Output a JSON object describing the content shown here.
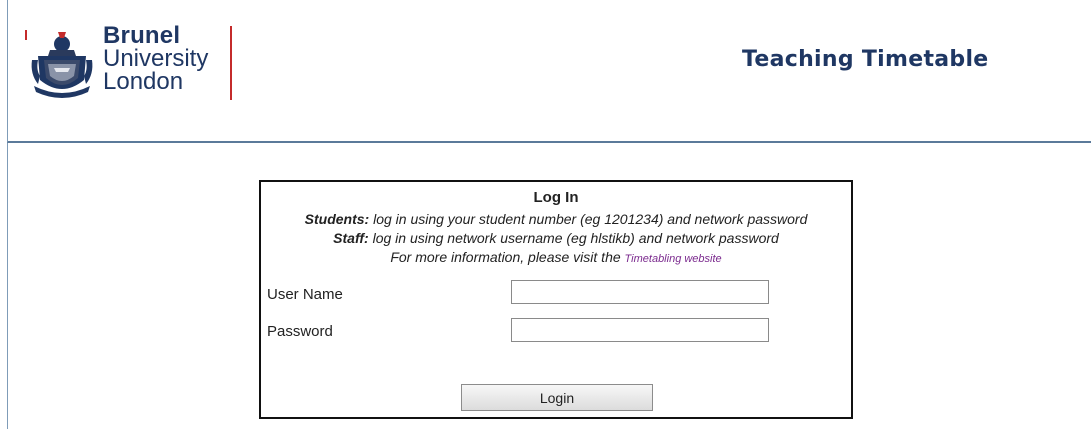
{
  "header": {
    "logo": {
      "line1": "Brunel",
      "line2": "University",
      "line3": "London"
    },
    "title": "Teaching Timetable"
  },
  "login": {
    "title": "Log In",
    "students_label": "Students:",
    "students_text": " log in using your student number (eg 1201234) and network password",
    "staff_label": "Staff:",
    "staff_text": " log in using network username (eg hlstikb) and network password",
    "info_text": "For more information, please visit the ",
    "link_text": "Timetabling website",
    "username_label": "User Name",
    "username_value": "",
    "password_label": "Password",
    "password_value": "",
    "button_label": "Login"
  },
  "colors": {
    "brand_navy": "#1f3763",
    "brand_red": "#c42b2b",
    "link_purple": "#7b2a8e"
  }
}
